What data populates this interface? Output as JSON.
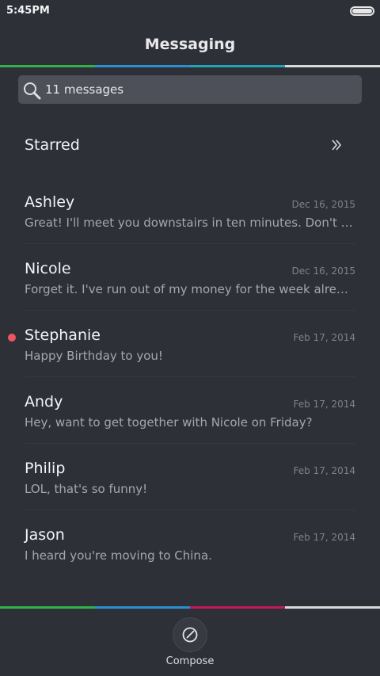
{
  "status_bar": {
    "time": "5:45PM",
    "battery_icon": "battery-icon"
  },
  "header": {
    "title": "Messaging"
  },
  "colors": {
    "strip_top": [
      "#2fb24a",
      "#2a8fd0",
      "#25a3b6",
      "#d9d9d9"
    ],
    "strip_bottom": [
      "#2fb24a",
      "#2a8fd0",
      "#c1185f",
      "#d9d9d9"
    ],
    "unread": "#f0545e"
  },
  "search": {
    "text": "11 messages",
    "icon": "search-icon"
  },
  "starred": {
    "label": "Starred",
    "icon": "chevron-right-double-icon"
  },
  "conversations": [
    {
      "name": "Ashley",
      "date": "Dec 16, 2015",
      "preview": "Great! I'll meet you downstairs in ten minutes. Don't forget to bring your umbrella",
      "unread": false
    },
    {
      "name": "Nicole",
      "date": "Dec 16, 2015",
      "preview": "Forget it. I've run out of my money for the week already.",
      "unread": false
    },
    {
      "name": "Stephanie",
      "date": "Feb 17, 2014",
      "preview": "Happy Birthday to you!",
      "unread": true
    },
    {
      "name": "Andy",
      "date": "Feb 17, 2014",
      "preview": "Hey, want to get together with Nicole on Friday?",
      "unread": false
    },
    {
      "name": "Philip",
      "date": "Feb 17, 2014",
      "preview": "LOL, that's so funny!",
      "unread": false
    },
    {
      "name": "Jason",
      "date": "Feb 17, 2014",
      "preview": "I heard you're moving to China.",
      "unread": false
    }
  ],
  "bottom": {
    "compose_label": "Compose",
    "compose_icon": "compose-icon"
  }
}
